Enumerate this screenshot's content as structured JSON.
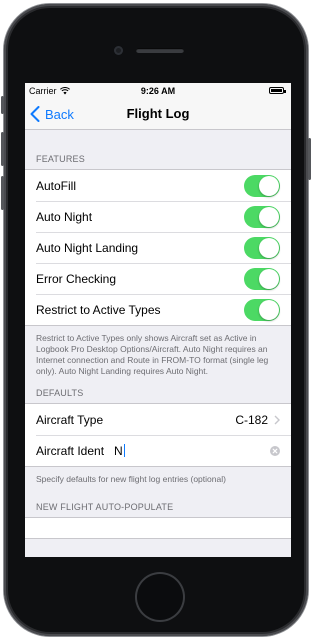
{
  "status_bar": {
    "carrier": "Carrier",
    "time": "9:26 AM"
  },
  "nav": {
    "back_label": "Back",
    "title": "Flight Log"
  },
  "features": {
    "header": "FEATURES",
    "items": [
      {
        "label": "AutoFill",
        "on": true
      },
      {
        "label": "Auto Night",
        "on": true
      },
      {
        "label": "Auto Night Landing",
        "on": true
      },
      {
        "label": "Error Checking",
        "on": true
      },
      {
        "label": "Restrict to Active Types",
        "on": true
      }
    ],
    "footer": "Restrict to Active Types only shows Aircraft set as Active in Logbook Pro Desktop Options/Aircraft. Auto Night requires an Internet connection and Route in FROM-TO format (single leg only). Auto Night Landing requires Auto Night."
  },
  "defaults": {
    "header": "DEFAULTS",
    "aircraft_type_label": "Aircraft Type",
    "aircraft_type_value": "C-182",
    "aircraft_ident_label": "Aircraft Ident",
    "aircraft_ident_value": "N",
    "footer": "Specify defaults for new flight log entries (optional)"
  },
  "auto_populate": {
    "header": "NEW FLIGHT AUTO-POPULATE"
  },
  "colors": {
    "tint": "#0e7afe",
    "switch_on": "#4cd964"
  },
  "icons": {
    "wifi": "wifi-icon",
    "battery": "battery-icon",
    "back": "chevron-left-icon",
    "disclosure": "chevron-right-icon",
    "clear": "clear-icon"
  }
}
